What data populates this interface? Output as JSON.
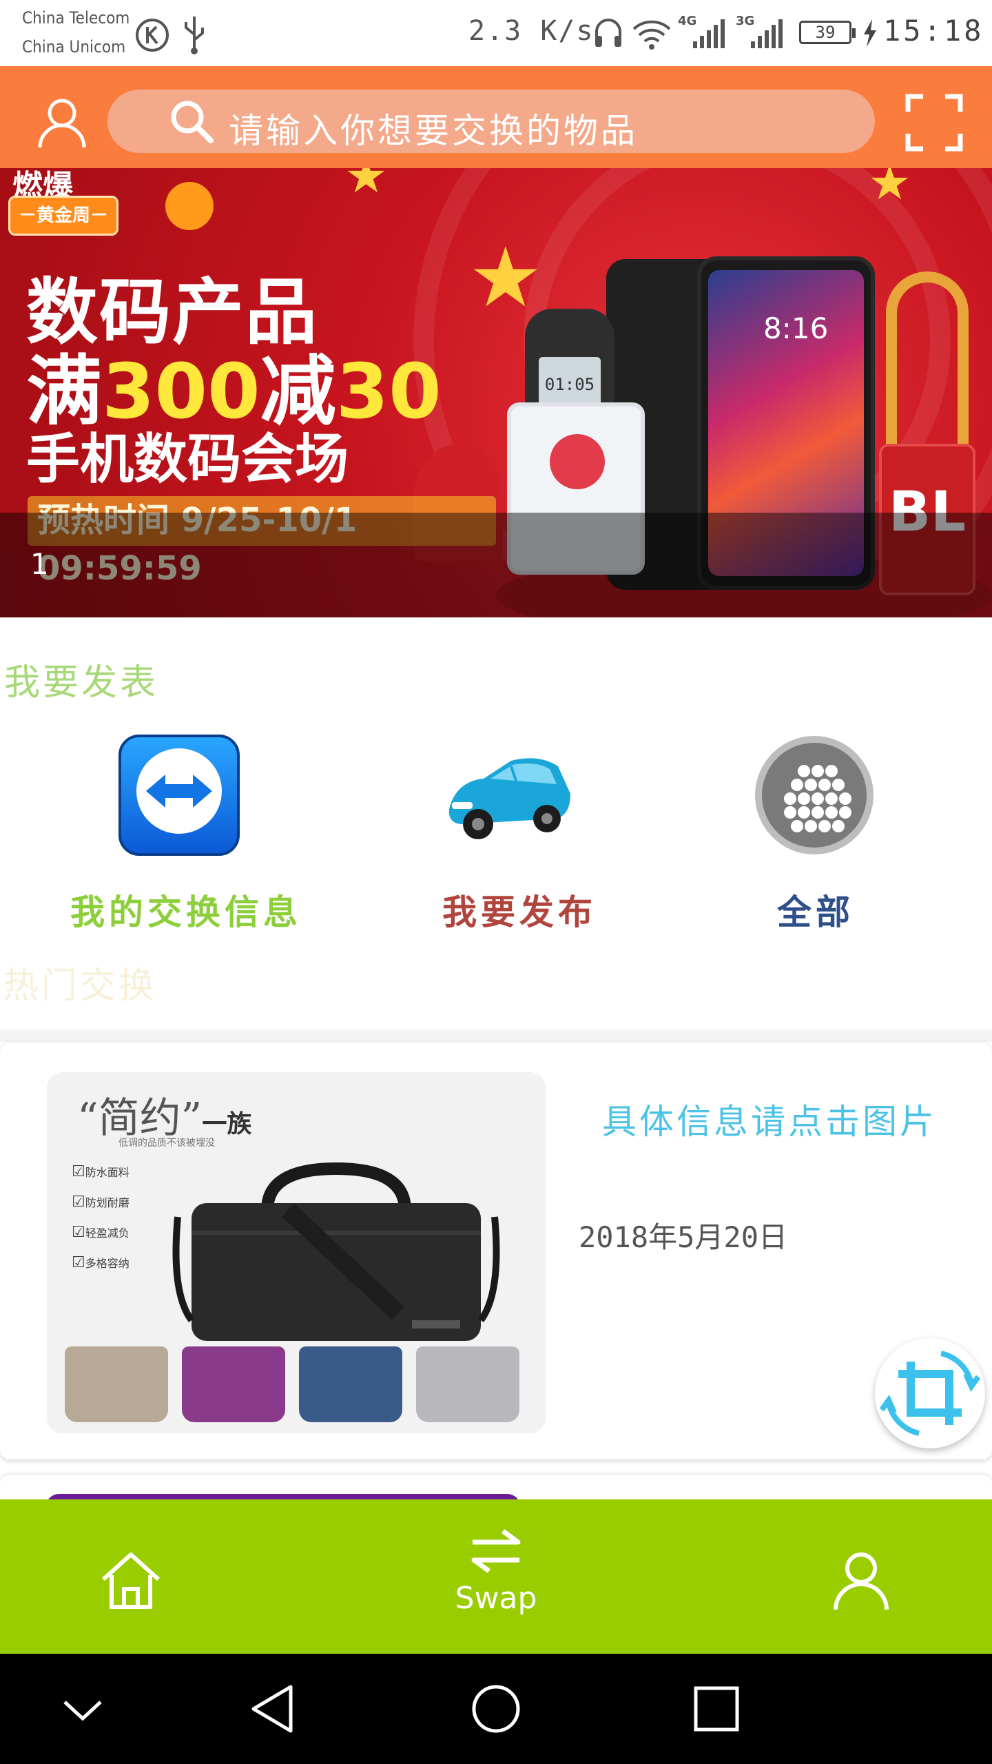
{
  "status_bar": {
    "carrier_1": "China Telecom",
    "carrier_2": "China Unicom",
    "net_speed": "2.3 K/s",
    "signal_1": "4G",
    "signal_2": "3G",
    "battery": "39",
    "time": "15:18"
  },
  "header": {
    "search_placeholder": "请输入你想要交换的物品"
  },
  "banner": {
    "tag": "－黄金周－",
    "line1": "数码产品",
    "line2_prefix": "满",
    "line2_hl1": "300",
    "line2_mid": "减",
    "line2_hl2": "30",
    "line3": "手机数码会场",
    "preheat": "预热时间 9/25-10/1 09:59:59",
    "index": "1",
    "phone_time": "8:16",
    "nokia_time": "01:05",
    "speaker_brand": "BL"
  },
  "publish_section": {
    "title": "我要发表",
    "actions": [
      {
        "label": "我的交换信息",
        "color": "#8ccf3a"
      },
      {
        "label": "我要发布",
        "color": "#b0453e"
      },
      {
        "label": "全部",
        "color": "#2f4f8a"
      }
    ]
  },
  "hot_section": {
    "title": "热门交换"
  },
  "cards": [
    {
      "title": "具体信息请点击图片",
      "date": "2018年5月20日",
      "image": {
        "title_big": "“简约”",
        "title_small": "一族",
        "subtitle": "低调的品质不该被埋没",
        "features": [
          "防水面料",
          "防划耐磨",
          "轻盈减负",
          "多格容纳"
        ]
      }
    }
  ],
  "bottom_nav": {
    "items": [
      {
        "label": "",
        "icon": "home-icon"
      },
      {
        "label": "Swap",
        "icon": "swap-icon"
      },
      {
        "label": "",
        "icon": "person-icon"
      }
    ]
  },
  "colors": {
    "header": "#fb7d3d",
    "bottom_nav": "#9acd00",
    "card_title": "#4cc3e6"
  }
}
